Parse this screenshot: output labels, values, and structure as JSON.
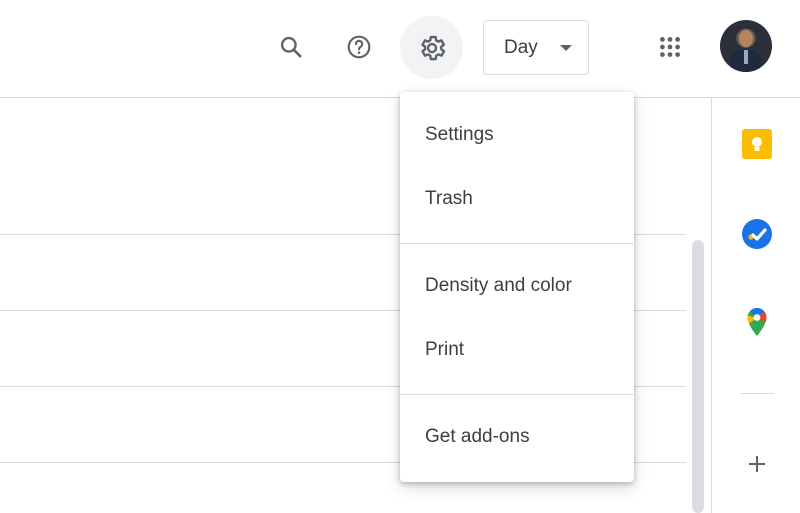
{
  "header": {
    "view_selector": {
      "selected": "Day"
    }
  },
  "icons": {
    "search": "search-icon",
    "help": "help-icon",
    "settings": "gear-icon",
    "apps": "apps-grid-icon",
    "avatar": "avatar"
  },
  "settings_menu": {
    "items": [
      {
        "label": "Settings"
      },
      {
        "label": "Trash"
      },
      {
        "label": "Density and color"
      },
      {
        "label": "Print"
      },
      {
        "label": "Get add-ons"
      }
    ]
  },
  "side_panel": {
    "apps": [
      "keep-icon",
      "tasks-icon",
      "maps-icon",
      "add-icon"
    ]
  },
  "colors": {
    "keep": "#fbbc04",
    "tasks": "#1a73e8",
    "divider": "#dadce0",
    "text": "#3c4043"
  }
}
